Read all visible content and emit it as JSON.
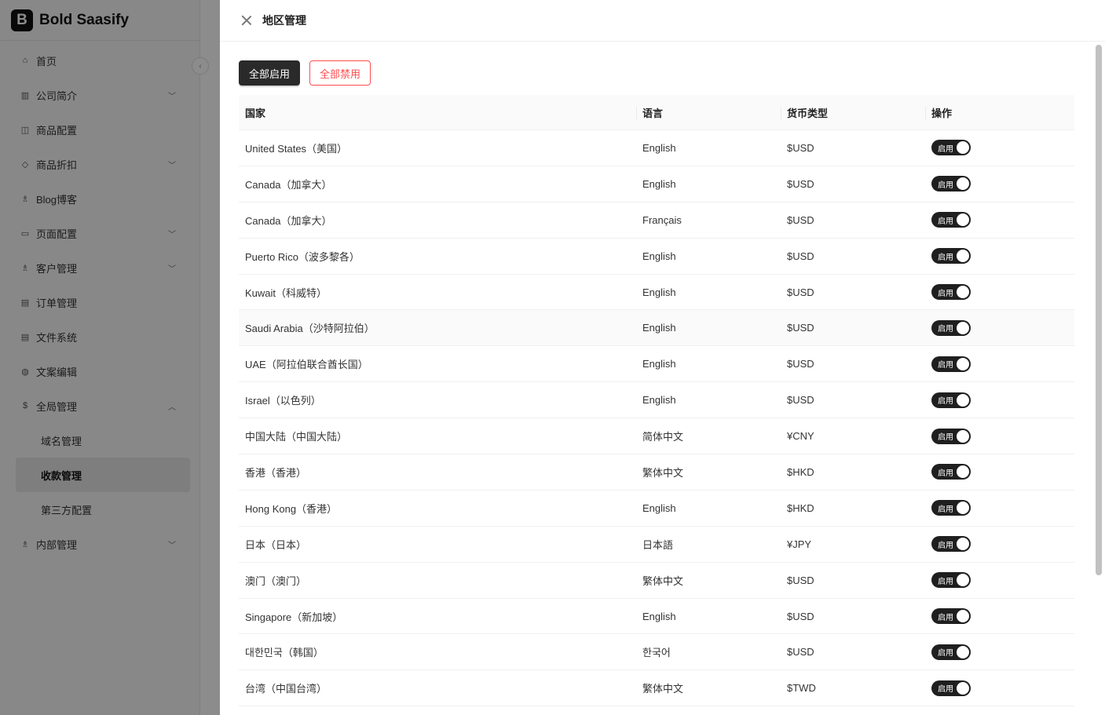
{
  "brand": {
    "logo_letter": "B",
    "name": "Bold Saasify"
  },
  "sidebar": {
    "collapse_icon": "chevron-left-icon",
    "items": [
      {
        "label": "首页",
        "icon": "home-icon",
        "glyph": "⌂",
        "has_chevron": false
      },
      {
        "label": "公司简介",
        "icon": "building-icon",
        "glyph": "▥",
        "has_chevron": true
      },
      {
        "label": "商品配置",
        "icon": "box-icon",
        "glyph": "◫",
        "has_chevron": false
      },
      {
        "label": "商品折扣",
        "icon": "tag-icon",
        "glyph": "◇",
        "has_chevron": true
      },
      {
        "label": "Blog博客",
        "icon": "users-icon",
        "glyph": "♗",
        "has_chevron": false
      },
      {
        "label": "页面配置",
        "icon": "monitor-icon",
        "glyph": "▭",
        "has_chevron": true
      },
      {
        "label": "客户管理",
        "icon": "customers-icon",
        "glyph": "♗",
        "has_chevron": true
      },
      {
        "label": "订单管理",
        "icon": "order-icon",
        "glyph": "▤",
        "has_chevron": false
      },
      {
        "label": "文件系统",
        "icon": "file-icon",
        "glyph": "▤",
        "has_chevron": false
      },
      {
        "label": "文案编辑",
        "icon": "globe-icon",
        "glyph": "◍",
        "has_chevron": false
      },
      {
        "label": "全局管理",
        "icon": "dollar-circle-icon",
        "glyph": "$",
        "has_chevron": true,
        "expanded": true
      }
    ],
    "sub_items": [
      {
        "label": "域名管理",
        "active": false
      },
      {
        "label": "收款管理",
        "active": true
      },
      {
        "label": "第三方配置",
        "active": false
      }
    ],
    "last_item": {
      "label": "内部管理",
      "icon": "team-icon",
      "glyph": "♗",
      "has_chevron": true
    }
  },
  "drawer": {
    "title": "地区管理",
    "enable_all_label": "全部启用",
    "disable_all_label": "全部禁用",
    "columns": [
      "国家",
      "语言",
      "货币类型",
      "操作"
    ],
    "switch_label": "启用",
    "rows": [
      {
        "country": "United States（美国）",
        "language": "English",
        "currency": "$USD",
        "enabled": true
      },
      {
        "country": "Canada（加拿大）",
        "language": "English",
        "currency": "$USD",
        "enabled": true
      },
      {
        "country": "Canada（加拿大）",
        "language": "Français",
        "currency": "$USD",
        "enabled": true
      },
      {
        "country": "Puerto Rico（波多黎各）",
        "language": "English",
        "currency": "$USD",
        "enabled": true
      },
      {
        "country": "Kuwait（科威特）",
        "language": "English",
        "currency": "$USD",
        "enabled": true
      },
      {
        "country": "Saudi Arabia（沙特阿拉伯）",
        "language": "English",
        "currency": "$USD",
        "enabled": true
      },
      {
        "country": "UAE（阿拉伯联合酋长国）",
        "language": "English",
        "currency": "$USD",
        "enabled": true
      },
      {
        "country": "Israel（以色列）",
        "language": "English",
        "currency": "$USD",
        "enabled": true
      },
      {
        "country": "中国大陆（中国大陆）",
        "language": "简体中文",
        "currency": "¥CNY",
        "enabled": true
      },
      {
        "country": "香港（香港）",
        "language": "繁体中文",
        "currency": "$HKD",
        "enabled": true
      },
      {
        "country": "Hong Kong（香港）",
        "language": "English",
        "currency": "$HKD",
        "enabled": true
      },
      {
        "country": "日本（日本）",
        "language": "日本語",
        "currency": "¥JPY",
        "enabled": true
      },
      {
        "country": "澳门（澳门）",
        "language": "繁体中文",
        "currency": "$USD",
        "enabled": true
      },
      {
        "country": "Singapore（新加坡）",
        "language": "English",
        "currency": "$USD",
        "enabled": true
      },
      {
        "country": "대한민국（韩国）",
        "language": "한국어",
        "currency": "$USD",
        "enabled": true
      },
      {
        "country": "台湾（中国台湾）",
        "language": "繁体中文",
        "currency": "$TWD",
        "enabled": true
      }
    ]
  }
}
